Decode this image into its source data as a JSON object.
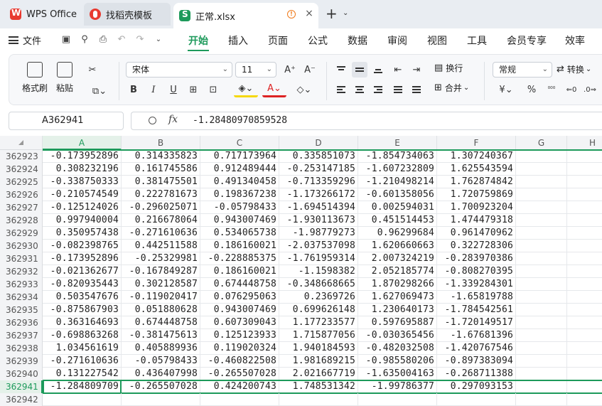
{
  "tabs": [
    {
      "label": "WPS Office",
      "icon": "wps-logo-icon"
    },
    {
      "label": "找稻壳模板",
      "icon": "daoke-logo-icon"
    },
    {
      "label": "正常.xlsx",
      "icon": "spreadsheet-logo-icon"
    }
  ],
  "menu": {
    "file_label": "文件",
    "tabs": [
      "开始",
      "插入",
      "页面",
      "公式",
      "数据",
      "审阅",
      "视图",
      "工具",
      "会员专享",
      "效率"
    ],
    "active_tab": "开始"
  },
  "ribbon": {
    "format_painter": "格式刷",
    "paste": "粘贴",
    "font_name": "宋体",
    "font_size": "11",
    "wrap_text": "换行",
    "merge": "合并",
    "number_format": "常规",
    "convert": "转换",
    "currency_symbol": "¥",
    "percent_symbol": "%"
  },
  "formula_bar": {
    "name_box": "A362941",
    "fx_label": "fx",
    "value": "-1.28480970859528"
  },
  "columns": [
    "A",
    "B",
    "C",
    "D",
    "E",
    "F",
    "G",
    "H"
  ],
  "active_column": "A",
  "active_row": "362941",
  "rows": [
    {
      "n": "362923",
      "cells": [
        "-0.173952896",
        "0.314335823",
        "0.717173964",
        "0.335851073",
        "-1.854734063",
        "1.307240367"
      ]
    },
    {
      "n": "362924",
      "cells": [
        "0.308232196",
        "0.161745586",
        "0.912489444",
        "-0.253147185",
        "-1.607232809",
        "1.625543594"
      ]
    },
    {
      "n": "362925",
      "cells": [
        "-0.338750333",
        "0.381475501",
        "0.491340458",
        "-0.713359296",
        "-1.210498214",
        "1.762874842"
      ]
    },
    {
      "n": "362926",
      "cells": [
        "-0.210574549",
        "0.222781673",
        "0.198367238",
        "-1.173266172",
        "-0.601358056",
        "1.720759869"
      ]
    },
    {
      "n": "362927",
      "cells": [
        "-0.125124026",
        "-0.296025071",
        "-0.05798433",
        "-1.694514394",
        "0.002594031",
        "1.700923204"
      ]
    },
    {
      "n": "362928",
      "cells": [
        "0.997940004",
        "0.216678064",
        "0.943007469",
        "-1.930113673",
        "0.451514453",
        "1.474479318"
      ]
    },
    {
      "n": "362929",
      "cells": [
        "0.350957438",
        "-0.271610636",
        "0.534065738",
        "-1.98779273",
        "0.96299684",
        "0.961470962"
      ]
    },
    {
      "n": "362930",
      "cells": [
        "-0.082398765",
        "0.442511588",
        "0.186160021",
        "-2.037537098",
        "1.620660663",
        "0.322728306"
      ]
    },
    {
      "n": "362931",
      "cells": [
        "-0.173952896",
        "-0.25329981",
        "-0.228885375",
        "-1.761959314",
        "2.007324219",
        "-0.283970386"
      ]
    },
    {
      "n": "362932",
      "cells": [
        "-0.021362677",
        "-0.167849287",
        "0.186160021",
        "-1.1598382",
        "2.052185774",
        "-0.808270395"
      ]
    },
    {
      "n": "362933",
      "cells": [
        "-0.820935443",
        "0.302128587",
        "0.674448758",
        "-0.348668665",
        "1.870298266",
        "-1.339284301"
      ]
    },
    {
      "n": "362934",
      "cells": [
        "0.503547676",
        "-0.119020417",
        "0.076295063",
        "0.2369726",
        "1.627069473",
        "-1.65819788"
      ]
    },
    {
      "n": "362935",
      "cells": [
        "-0.875867903",
        "0.051880628",
        "0.943007469",
        "0.699626148",
        "1.230640173",
        "-1.784542561"
      ]
    },
    {
      "n": "362936",
      "cells": [
        "0.363164693",
        "0.674448758",
        "0.607309043",
        "1.177233577",
        "0.597695887",
        "-1.720149517"
      ]
    },
    {
      "n": "362937",
      "cells": [
        "-0.698863268",
        "-0.381475613",
        "0.125123933",
        "1.715877056",
        "-0.030365456",
        "-1.67681396"
      ]
    },
    {
      "n": "362938",
      "cells": [
        "1.034561619",
        "0.405889936",
        "0.119020324",
        "1.940184593",
        "-0.482032508",
        "-1.420767546"
      ]
    },
    {
      "n": "362939",
      "cells": [
        "-0.271610636",
        "-0.05798433",
        "-0.460822508",
        "1.981689215",
        "-0.985580206",
        "-0.897383094"
      ]
    },
    {
      "n": "362940",
      "cells": [
        "0.131227542",
        "0.436407998",
        "-0.265507028",
        "2.021667719",
        "-1.635004163",
        "-0.268711388"
      ]
    },
    {
      "n": "362941",
      "cells": [
        "-1.284809709",
        "-0.265507028",
        "0.424200743",
        "1.748531342",
        "-1.99786377",
        "0.297093153"
      ]
    },
    {
      "n": "362942",
      "cells": [
        "",
        "",
        "",
        "",
        "",
        ""
      ]
    }
  ],
  "colors": {
    "accent": "#1d9a5b",
    "tab_bar": "#e9edf2",
    "wps_red": "#e83a30"
  }
}
